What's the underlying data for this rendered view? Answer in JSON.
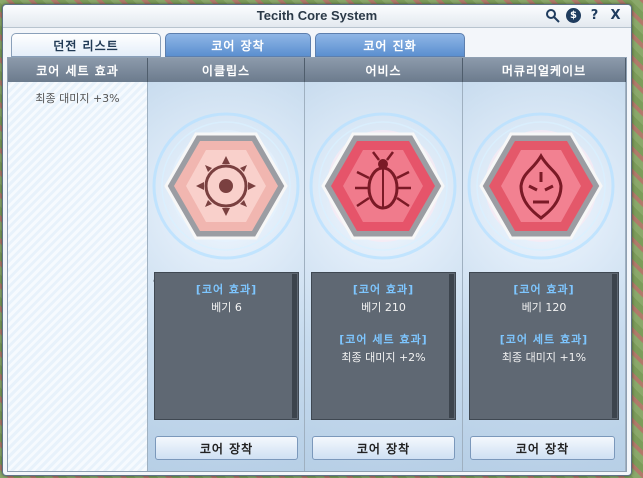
{
  "window": {
    "title": "Tecith Core System"
  },
  "titlebar_icons": [
    "search-person-icon",
    "coin-icon",
    "help-icon",
    "close-icon"
  ],
  "titlebar_icon_glyphs": {
    "coin": "$",
    "help": "?",
    "close": "X"
  },
  "tabs": [
    {
      "label": "던전 리스트",
      "active": true
    },
    {
      "label": "코어 장착",
      "active": false
    },
    {
      "label": "코어 진화",
      "active": false
    }
  ],
  "set_panel": {
    "header": "코어 세트 효과",
    "effect": "최종 대미지 +3%"
  },
  "nav": {
    "prev": "«",
    "next": "»"
  },
  "cores": [
    {
      "name": "이클립스",
      "emblem": "sun-eye-emblem",
      "color": "#e8a6a2",
      "effect_title": "[코어 효과]",
      "effect_value": "베기 6",
      "set_title": "",
      "set_value": "",
      "button": "코어 장착"
    },
    {
      "name": "어비스",
      "emblem": "beetle-emblem",
      "color": "#e6546a",
      "effect_title": "[코어 효과]",
      "effect_value": "베기 210",
      "set_title": "[코어 세트 효과]",
      "set_value": "최종 대미지 +2%",
      "button": "코어 장착"
    },
    {
      "name": "머큐리얼케이브",
      "emblem": "flame-mask-emblem",
      "color": "#e4586a",
      "effect_title": "[코어 효과]",
      "effect_value": "베기 120",
      "set_title": "[코어 세트 효과]",
      "set_value": "최종 대미지 +1%",
      "button": "코어 장착"
    }
  ]
}
